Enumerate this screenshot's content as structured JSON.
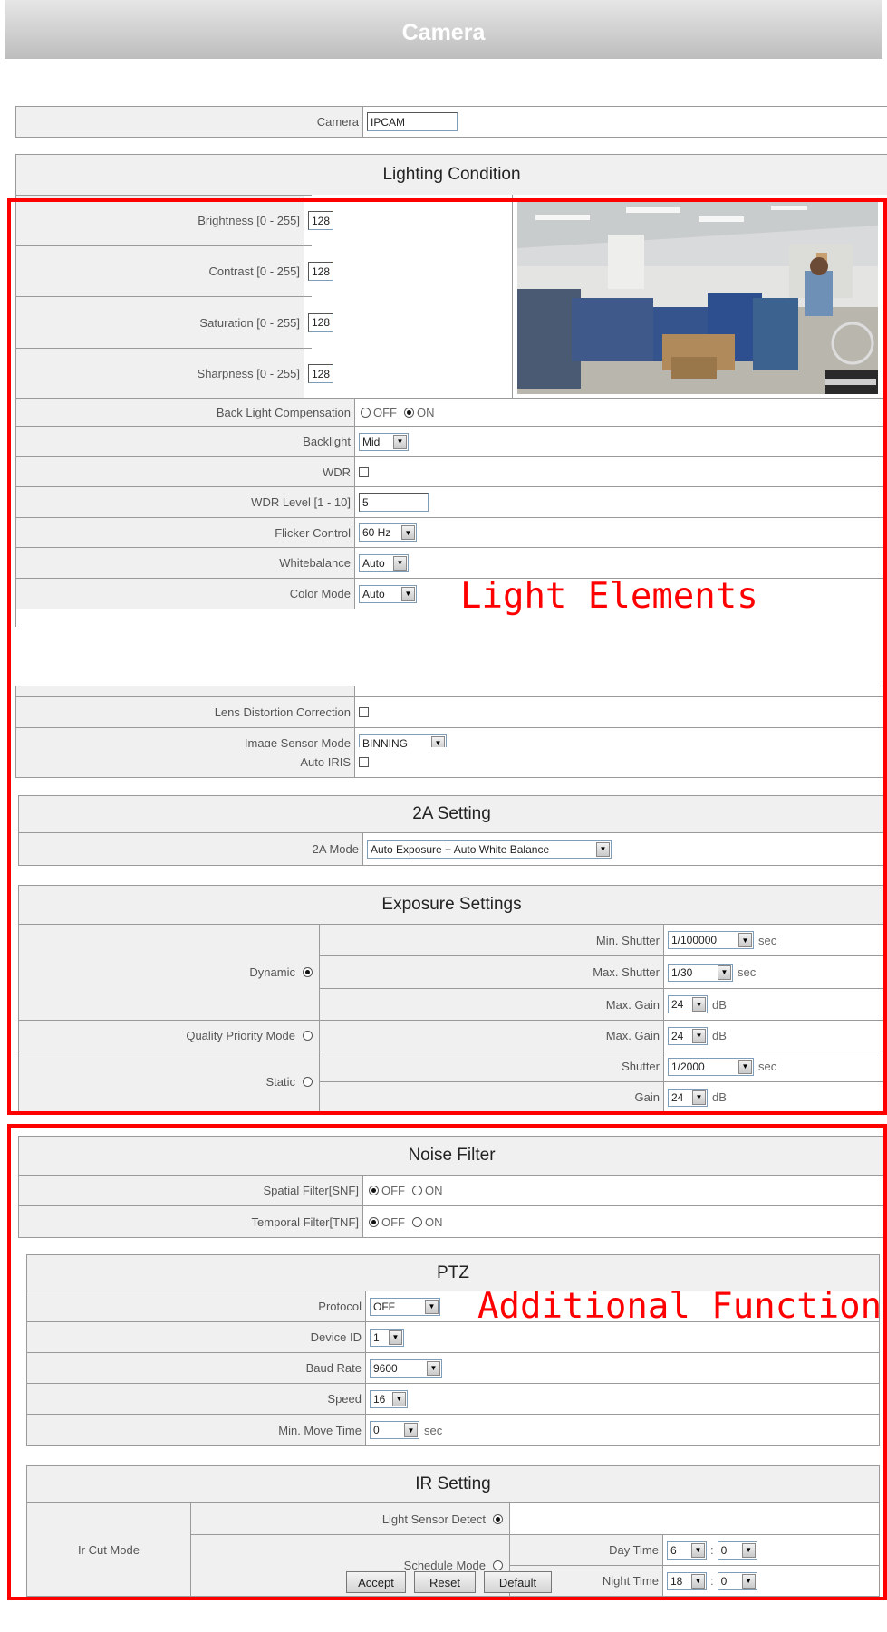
{
  "page": {
    "title": "Camera"
  },
  "camera": {
    "label": "Camera",
    "value": "IPCAM"
  },
  "lighting": {
    "heading": "Lighting Condition",
    "brightness": {
      "label": "Brightness [0 - 255]",
      "value": "128"
    },
    "contrast": {
      "label": "Contrast [0 - 255]",
      "value": "128"
    },
    "saturation": {
      "label": "Saturation [0 - 255]",
      "value": "128"
    },
    "sharpness": {
      "label": "Sharpness [0 - 255]",
      "value": "128"
    },
    "blc": {
      "label": "Back Light Compensation",
      "off": "OFF",
      "on": "ON",
      "selected": "ON"
    },
    "backlight": {
      "label": "Backlight",
      "value": "Mid"
    },
    "wdr": {
      "label": "WDR",
      "checked": false
    },
    "wdr_level": {
      "label": "WDR Level [1 - 10]",
      "value": "5"
    },
    "flicker": {
      "label": "Flicker Control",
      "value": "60 Hz"
    },
    "whitebalance": {
      "label": "Whitebalance",
      "value": "Auto"
    },
    "color_mode": {
      "label": "Color Mode",
      "value": "Auto"
    },
    "lens": {
      "label": "Lens Distortion Correction",
      "checked": false
    },
    "sensor_mode": {
      "label": "Image Sensor Mode",
      "value": "BINNING"
    },
    "auto_iris": {
      "label": "Auto IRIS",
      "checked": false
    }
  },
  "two_a": {
    "heading": "2A Setting",
    "label": "2A Mode",
    "value": "Auto Exposure + Auto White Balance"
  },
  "exposure": {
    "heading": "Exposure Settings",
    "dynamic": "Dynamic",
    "quality": "Quality Priority Mode",
    "static": "Static",
    "min_shutter": {
      "label": "Min. Shutter",
      "value": "1/100000",
      "unit": "sec"
    },
    "max_shutter": {
      "label": "Max. Shutter",
      "value": "1/30",
      "unit": "sec"
    },
    "dyn_gain": {
      "label": "Max. Gain",
      "value": "24",
      "unit": "dB"
    },
    "qp_gain": {
      "label": "Max. Gain",
      "value": "24",
      "unit": "dB"
    },
    "shutter": {
      "label": "Shutter",
      "value": "1/2000",
      "unit": "sec"
    },
    "gain": {
      "label": "Gain",
      "value": "24",
      "unit": "dB"
    }
  },
  "noise": {
    "heading": "Noise Filter",
    "snf": {
      "label": "Spatial Filter[SNF]",
      "off": "OFF",
      "on": "ON"
    },
    "tnf": {
      "label": "Temporal Filter[TNF]",
      "off": "OFF",
      "on": "ON"
    }
  },
  "ptz": {
    "heading": "PTZ",
    "protocol": {
      "label": "Protocol",
      "value": "OFF"
    },
    "device_id": {
      "label": "Device ID",
      "value": "1"
    },
    "baud": {
      "label": "Baud Rate",
      "value": "9600"
    },
    "speed": {
      "label": "Speed",
      "value": "16"
    },
    "move_time": {
      "label": "Min. Move Time",
      "value": "0",
      "unit": "sec"
    }
  },
  "ir": {
    "heading": "IR Setting",
    "mode_label": "Ir Cut Mode",
    "light_sensor": "Light Sensor Detect",
    "schedule": "Schedule Mode",
    "day": {
      "label": "Day Time",
      "hour": "6",
      "min": "0"
    },
    "night": {
      "label": "Night Time",
      "hour": "18",
      "min": "0"
    },
    "sep": ":"
  },
  "annotations": {
    "light": "Light Elements",
    "additional": "Additional Function"
  },
  "buttons": {
    "accept": "Accept",
    "reset": "Reset",
    "default": "Default"
  }
}
